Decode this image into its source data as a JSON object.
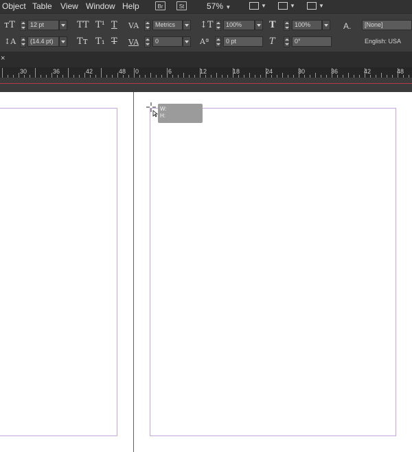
{
  "menu": {
    "items": [
      "Object",
      "Table",
      "View",
      "Window",
      "Help"
    ]
  },
  "app_bar": {
    "bridge": "Br",
    "stock": "St",
    "zoom": "57%"
  },
  "control_panel": {
    "font_size": "12 pt",
    "leading": "(14.4 pt)",
    "kerning": "Metrics",
    "tracking": "0",
    "vertical_scale": "100%",
    "horizontal_scale": "100%",
    "baseline_shift": "0 pt",
    "skew": "0°",
    "character_style": "[None]",
    "language": "English: USA",
    "char_style_icon": "A."
  },
  "tab": {
    "close": "×"
  },
  "ruler": {
    "labels": [
      "30",
      "36",
      "42",
      "48",
      "0",
      "6",
      "12",
      "18",
      "24",
      "30",
      "36",
      "42",
      "48"
    ]
  },
  "tooltip": {
    "w": "W:",
    "h": "H:"
  }
}
